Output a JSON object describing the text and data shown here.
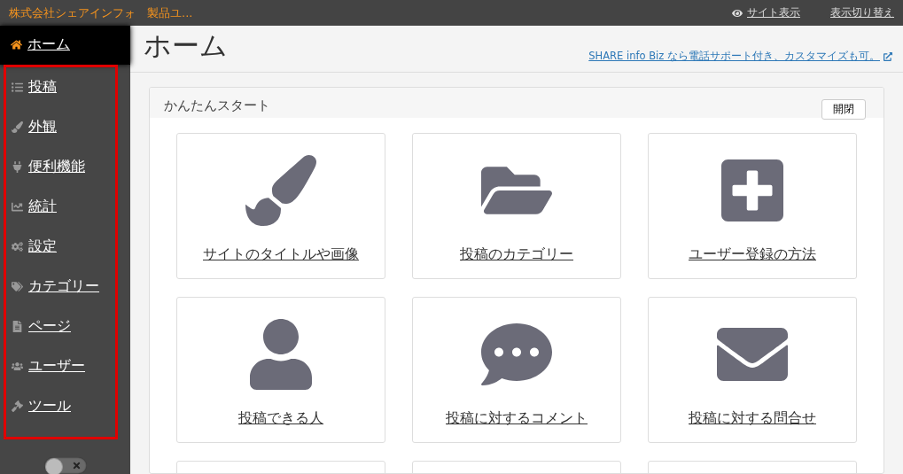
{
  "top_bar": {
    "site_name": "株式会社シェアインフォ　製品ユ...",
    "view_site": "サイト表示",
    "switch_view": "表示切り替え"
  },
  "sidebar": {
    "highlighted": true,
    "items": [
      {
        "kind": "home",
        "label": "ホーム",
        "selected": true
      },
      {
        "kind": "posts",
        "label": "投稿",
        "selected": false
      },
      {
        "kind": "appearance",
        "label": "外観",
        "selected": false
      },
      {
        "kind": "plugins",
        "label": "便利機能",
        "selected": false
      },
      {
        "kind": "stats",
        "label": "統計",
        "selected": false
      },
      {
        "kind": "settings",
        "label": "設定",
        "selected": false
      },
      {
        "kind": "categories",
        "label": "カテゴリー",
        "selected": false
      },
      {
        "kind": "pages",
        "label": "ページ",
        "selected": false
      },
      {
        "kind": "users",
        "label": "ユーザー",
        "selected": false
      },
      {
        "kind": "tools",
        "label": "ツール",
        "selected": false
      }
    ],
    "toggle": {
      "on": false
    }
  },
  "page": {
    "title": "ホーム",
    "promo_link": "SHARE info Biz なら電話サポート付き、カスタマイズも可。"
  },
  "quick_start": {
    "title": "かんたんスタート",
    "toggle_button": "開閉",
    "cards": [
      {
        "kind": "brush",
        "label": "サイトのタイトルや画像"
      },
      {
        "kind": "folder",
        "label": "投稿のカテゴリー"
      },
      {
        "kind": "plus",
        "label": "ユーザー登録の方法"
      },
      {
        "kind": "user",
        "label": "投稿できる人"
      },
      {
        "kind": "comment",
        "label": "投稿に対するコメント"
      },
      {
        "kind": "envelope",
        "label": "投稿に対する問合せ"
      },
      {
        "kind": "blank"
      },
      {
        "kind": "blank"
      },
      {
        "kind": "blank"
      }
    ]
  }
}
